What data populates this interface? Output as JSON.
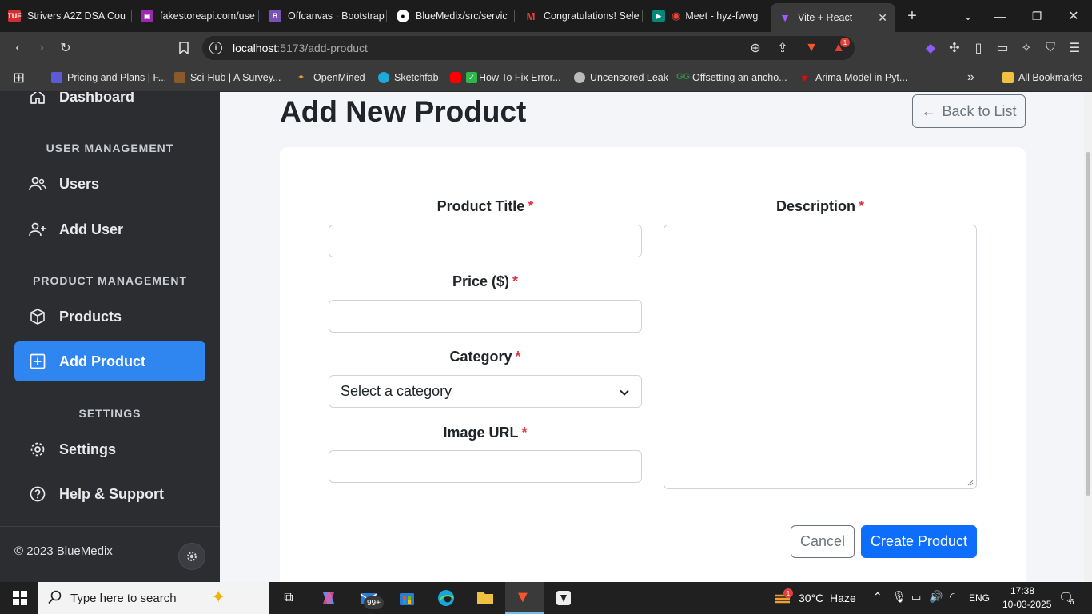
{
  "browser": {
    "tabs": [
      {
        "title": "Strivers A2Z DSA Cou",
        "favicon": "tuf-icon",
        "color": "#d32f2f"
      },
      {
        "title": "fakestoreapi.com/use",
        "favicon": "fakestore-icon",
        "color": "#9c27b0"
      },
      {
        "title": "Offcanvas · Bootstrap",
        "favicon": "bootstrap-icon",
        "color": "#7952b3"
      },
      {
        "title": "BlueMedix/src/servic",
        "favicon": "github-icon",
        "color": "#ffffff"
      },
      {
        "title": "Congratulations! Sele",
        "favicon": "gmail-icon",
        "color": "#ea4335"
      },
      {
        "title": "Meet - hyz-fwwg",
        "favicon": "meet-icon",
        "color": "#00897b"
      },
      {
        "title": "Vite + React",
        "favicon": "vite-icon",
        "color": "#a259ff"
      }
    ],
    "new_tab_label": "+",
    "url_host": "localhost",
    "url_rest": ":5173/add-product",
    "extension_badge": "1",
    "bookmarks": [
      {
        "label": "Pricing and Plans | F...",
        "color": "#5b5bd6"
      },
      {
        "label": "Sci-Hub | A Survey...",
        "color": "#8b5a2b"
      },
      {
        "label": "OpenMined",
        "color": "#f0a030"
      },
      {
        "label": "Sketchfab",
        "color": "#1caad9"
      },
      {
        "label": "How To Fix Error...",
        "color": "#ff0000"
      },
      {
        "label": "Uncensored Leak",
        "color": "#bbbbbb"
      },
      {
        "label": "Offsetting an ancho...",
        "color": "#2f8d46"
      },
      {
        "label": "Arima Model in Pyt...",
        "color": "#e50914"
      }
    ],
    "more_bookmarks": "»",
    "all_bookmarks": "All Bookmarks"
  },
  "sidebar": {
    "dashboard": "Dashboard",
    "section_user": "USER MANAGEMENT",
    "users": "Users",
    "add_user": "Add User",
    "section_product": "PRODUCT MANAGEMENT",
    "products": "Products",
    "add_product": "Add Product",
    "section_settings": "SETTINGS",
    "settings": "Settings",
    "help": "Help & Support",
    "copyright": "© 2023 BlueMedix"
  },
  "page": {
    "title": "Add New Product",
    "back_label": "Back to List",
    "form": {
      "title_label": "Product Title",
      "title_value": "",
      "price_label": "Price ($)",
      "price_value": "",
      "category_label": "Category",
      "category_selected": "Select a category",
      "image_label": "Image URL",
      "image_value": "",
      "description_label": "Description",
      "description_value": "",
      "required_mark": "*"
    },
    "cancel_label": "Cancel",
    "create_label": "Create Product"
  },
  "taskbar": {
    "search_placeholder": "Type here to search",
    "mail_badge": "99+",
    "weather": "30°C  Haze",
    "weather_badge": "1",
    "language": "ENG",
    "time": "17:38",
    "date": "10-03-2025",
    "notification_count": "6"
  }
}
